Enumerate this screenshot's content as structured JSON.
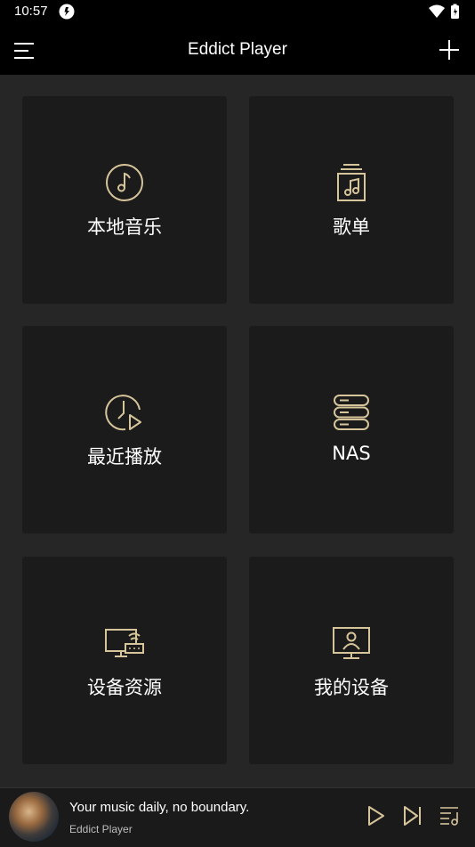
{
  "status_bar": {
    "time": "10:57"
  },
  "app_bar": {
    "title": "Eddict Player"
  },
  "tiles": [
    {
      "label": "本地音乐",
      "icon": "music-note-icon"
    },
    {
      "label": "歌单",
      "icon": "playlist-icon"
    },
    {
      "label": "最近播放",
      "icon": "recent-play-icon"
    },
    {
      "label": "NAS",
      "icon": "nas-server-icon"
    },
    {
      "label": "设备资源",
      "icon": "device-source-icon"
    },
    {
      "label": "我的设备",
      "icon": "my-device-icon"
    }
  ],
  "player": {
    "title": "Your music daily, no boundary.",
    "artist": "Eddict Player"
  },
  "colors": {
    "accent": "#d6c49a",
    "background": "#262626",
    "tile": "#1b1b1b",
    "bar": "#000000"
  }
}
